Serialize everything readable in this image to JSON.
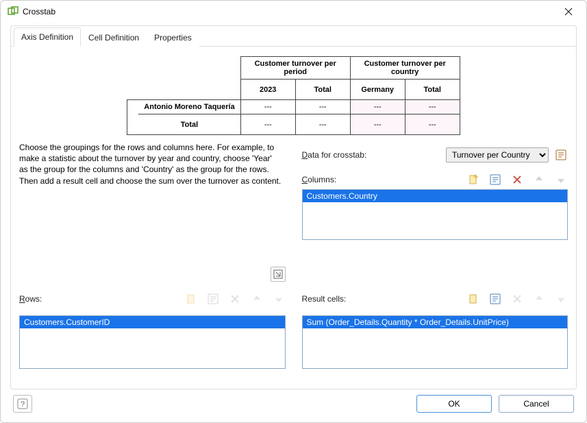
{
  "window": {
    "title": "Crosstab"
  },
  "tabs": {
    "axis": "Axis Definition",
    "cell": "Cell Definition",
    "props": "Properties"
  },
  "preview": {
    "colgroup1": "Customer turnover per period",
    "colgroup2": "Customer turnover per country",
    "col_year": "2023",
    "col_total1": "Total",
    "col_country": "Germany",
    "col_total2": "Total",
    "row1": "Antonio Moreno Taquería",
    "row_total": "Total",
    "cell": "---"
  },
  "help": {
    "text": "Choose the groupings for the rows and columns here. For example, to make a statistic about the turnover by year and country, choose 'Year' as the group for the columns and 'Country' as the group for the rows. Then add a result cell and choose the sum over the turnover as content."
  },
  "labels": {
    "rows": "Rows:",
    "rows_u": "R",
    "data_for_crosstab": "Data for crosstab:",
    "data_u": "D",
    "columns": "Columns:",
    "columns_u": "C",
    "result_cells": "Result cells:"
  },
  "data_combo": {
    "selected": "Turnover per Country",
    "options": [
      "Turnover per Country"
    ]
  },
  "lists": {
    "rows_selected": "Customers.CustomerID",
    "columns_selected": "Customers.Country",
    "results_selected": "Sum (Order_Details.Quantity * Order_Details.UnitPrice)"
  },
  "buttons": {
    "ok": "OK",
    "cancel": "Cancel"
  }
}
